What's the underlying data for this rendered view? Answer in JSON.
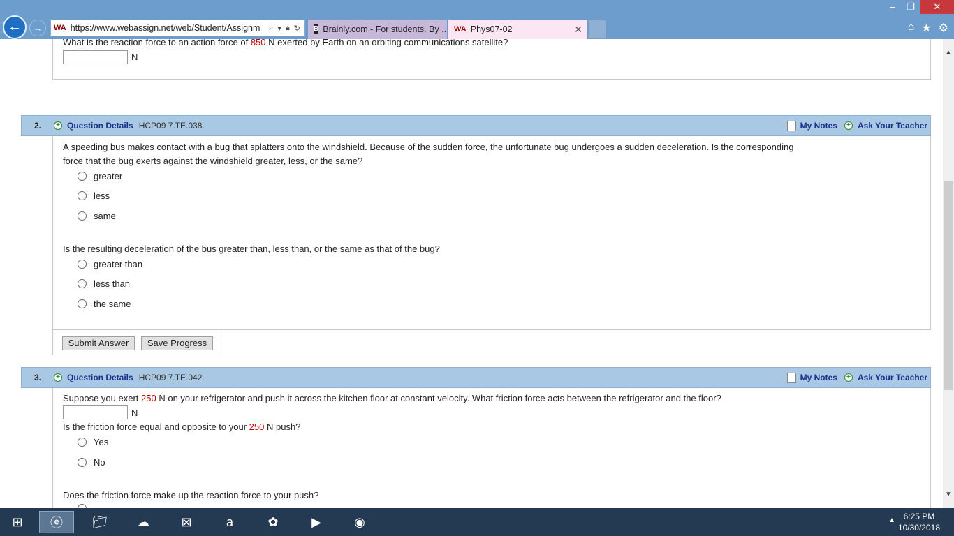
{
  "window": {
    "minimize": "–",
    "maximize": "❐",
    "close": "✕"
  },
  "browser": {
    "url": "https://www.webassign.net/web/Student/Assignm",
    "tabs": [
      {
        "label": "Brainly.com - For students. By ...",
        "favicon": "B"
      },
      {
        "label": "Phys07-02",
        "favicon": "WA",
        "close": "✕"
      }
    ],
    "icons": [
      "home-icon",
      "star-icon",
      "gear-icon"
    ]
  },
  "q1": {
    "text_before": "What is the reaction force to an action force of ",
    "value": "850",
    "text_after": " N exerted by Earth on an orbiting communications satellite?",
    "unit": "N"
  },
  "q2": {
    "number": "2.",
    "details_label": "Question Details",
    "code": "HCP09 7.TE.038.",
    "my_notes": "My Notes",
    "ask_teacher": "Ask Your Teacher",
    "text_line1": "A speeding bus makes contact with a bug that splatters onto the windshield. Because of the sudden force, the unfortunate bug undergoes a sudden deceleration. Is the corresponding",
    "text_line2": "force that the bug exerts against the windshield greater, less, or the same?",
    "options1": [
      "greater",
      "less",
      "same"
    ],
    "text2": "Is the resulting deceleration of the bus greater than, less than, or the same as that of the bug?",
    "options2": [
      "greater than",
      "less than",
      "the same"
    ],
    "submit": "Submit Answer",
    "save": "Save Progress"
  },
  "q3": {
    "number": "3.",
    "details_label": "Question Details",
    "code": "HCP09 7.TE.042.",
    "my_notes": "My Notes",
    "ask_teacher": "Ask Your Teacher",
    "text1_before": "Suppose you exert ",
    "value": "250",
    "text1_after": " N on your refrigerator and push it across the kitchen floor at constant velocity. What friction force acts between the refrigerator and the floor?",
    "unit": "N",
    "text2_before": "Is the friction force equal and opposite to your ",
    "value2": "250",
    "text2_after": " N push?",
    "options": [
      "Yes",
      "No"
    ],
    "text3": "Does the friction force make up the reaction force to your push?"
  },
  "taskbar": {
    "time": "6:25 PM",
    "date": "10/30/2018"
  }
}
